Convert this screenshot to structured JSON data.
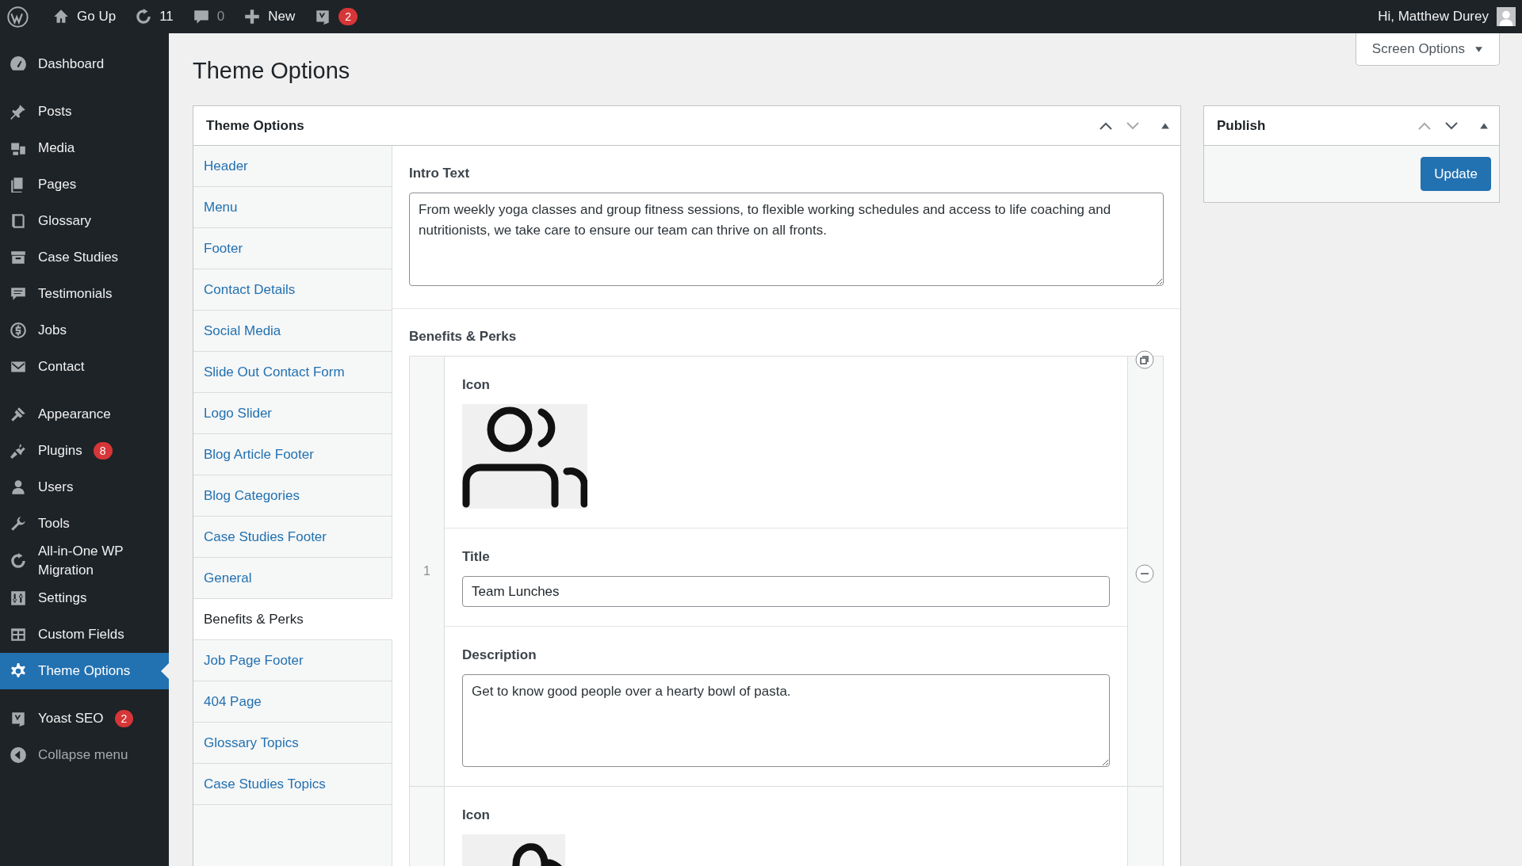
{
  "topbar": {
    "items": [
      {
        "label": "Go Up",
        "dim": false
      },
      {
        "label": "11",
        "dim": false
      },
      {
        "label": "0",
        "dim": true
      },
      {
        "label": "New",
        "dim": false
      }
    ],
    "yoast_badge": "2",
    "greeting": "Hi, Matthew Durey"
  },
  "sidebar": {
    "groups": [
      {
        "items": [
          {
            "label": "Dashboard",
            "selected": false
          }
        ]
      },
      {
        "items": [
          {
            "label": "Posts",
            "selected": false
          },
          {
            "label": "Media",
            "selected": false
          },
          {
            "label": "Pages",
            "selected": false
          },
          {
            "label": "Glossary",
            "selected": false
          },
          {
            "label": "Case Studies",
            "selected": false
          },
          {
            "label": "Testimonials",
            "selected": false
          },
          {
            "label": "Jobs",
            "selected": false
          },
          {
            "label": "Contact",
            "selected": false
          }
        ]
      },
      {
        "items": [
          {
            "label": "Appearance",
            "selected": false
          },
          {
            "label": "Plugins",
            "selected": false,
            "badge": "8"
          },
          {
            "label": "Users",
            "selected": false
          },
          {
            "label": "Tools",
            "selected": false
          },
          {
            "label": "All-in-One WP Migration",
            "selected": false
          },
          {
            "label": "Settings",
            "selected": false
          },
          {
            "label": "Custom Fields",
            "selected": false
          },
          {
            "label": "Theme Options",
            "selected": true
          }
        ]
      },
      {
        "items": [
          {
            "label": "Yoast SEO",
            "selected": false,
            "badge": "2"
          }
        ]
      }
    ],
    "collapse": "Collapse menu"
  },
  "page": {
    "title": "Theme Options",
    "screen_options": "Screen Options"
  },
  "metabox": {
    "title": "Theme Options",
    "move_up_disabled": false,
    "move_down_disabled": true,
    "tabs": [
      {
        "label": "Header",
        "selected": false
      },
      {
        "label": "Menu",
        "selected": false
      },
      {
        "label": "Footer",
        "selected": false
      },
      {
        "label": "Contact Details",
        "selected": false
      },
      {
        "label": "Social Media",
        "selected": false
      },
      {
        "label": "Slide Out Contact Form",
        "selected": false
      },
      {
        "label": "Logo Slider",
        "selected": false
      },
      {
        "label": "Blog Article Footer",
        "selected": false
      },
      {
        "label": "Blog Categories",
        "selected": false
      },
      {
        "label": "Case Studies Footer",
        "selected": false
      },
      {
        "label": "General",
        "selected": false
      },
      {
        "label": "Benefits & Perks",
        "selected": true
      },
      {
        "label": "Job Page Footer",
        "selected": false
      },
      {
        "label": "404 Page",
        "selected": false
      },
      {
        "label": "Glossary Topics",
        "selected": false
      },
      {
        "label": "Case Studies Topics",
        "selected": false
      }
    ],
    "intro": {
      "label": "Intro Text",
      "value": "From weekly yoga classes and group fitness sessions, to flexible working schedules and access to life coaching and nutritionists, we take care to ensure our team can thrive on all fronts."
    },
    "repeater": {
      "label": "Benefits & Perks",
      "rows": [
        {
          "number": "1",
          "fields": [
            {
              "kind": "image",
              "label": "Icon"
            },
            {
              "kind": "text",
              "label": "Title",
              "value": "Team Lunches"
            },
            {
              "kind": "textarea",
              "label": "Description",
              "value": "Get to know good people over a hearty bowl of pasta."
            }
          ]
        },
        {
          "fields": [
            {
              "kind": "image",
              "label": "Icon"
            }
          ]
        }
      ]
    }
  },
  "publish": {
    "title": "Publish",
    "move_up_disabled": true,
    "move_down_disabled": false,
    "button": "Update"
  }
}
